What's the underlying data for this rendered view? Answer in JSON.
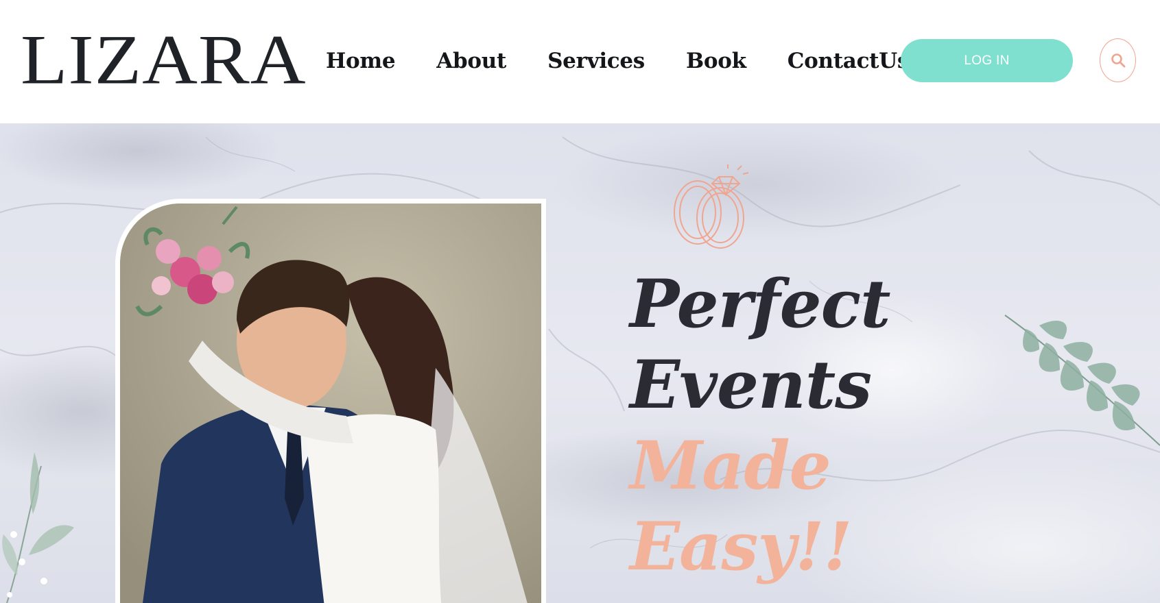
{
  "header": {
    "logo": "LIZARA",
    "nav": [
      "Home",
      "About",
      "Services",
      "Book",
      "ContactUs"
    ],
    "login_label": "LOG IN"
  },
  "hero": {
    "headline": {
      "line1": "Perfect",
      "line2": "Events",
      "line3": "Made",
      "line4": "Easy!!"
    }
  },
  "colors": {
    "accent_teal": "#7fe0cf",
    "accent_peach": "#f3b39b",
    "dark_text": "#1f2328"
  },
  "icons": [
    "search-icon",
    "wedding-rings-icon",
    "leaf-branch-icon"
  ]
}
